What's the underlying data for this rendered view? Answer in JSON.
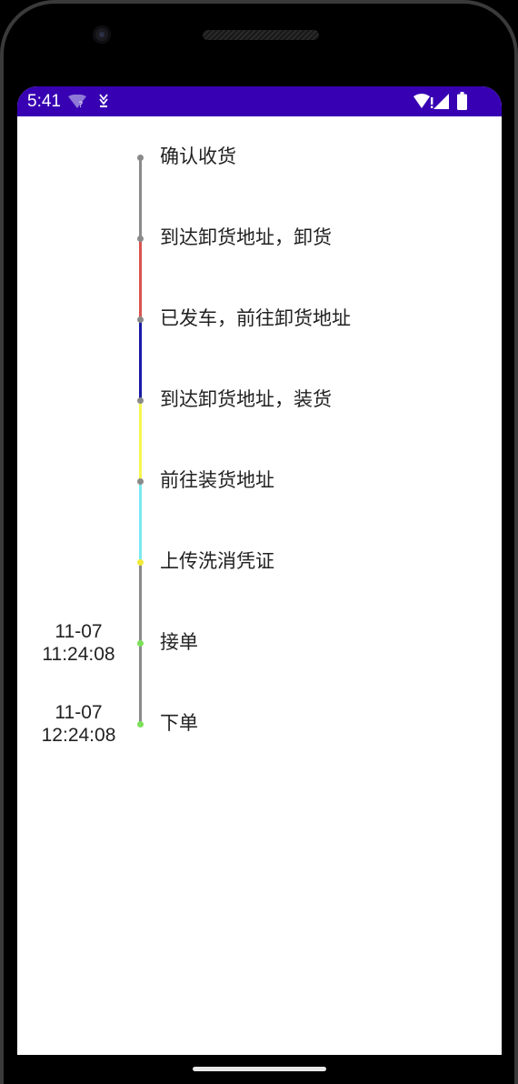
{
  "status_bar": {
    "time": "5:41",
    "wifi_badge": "?",
    "icons": [
      "wifi-question-icon",
      "download-icon",
      "wifi-alert-icon",
      "cell-signal-icon",
      "battery-icon"
    ],
    "color": "#3700b3"
  },
  "timeline": {
    "items": [
      {
        "label": "确认收货",
        "time_date": "",
        "time_clock": "",
        "dot_color": "#8a8a8a",
        "segment_color": "#8a8a8a"
      },
      {
        "label": "到达卸货地址，卸货",
        "time_date": "",
        "time_clock": "",
        "dot_color": "#8a8a8a",
        "segment_color": "#d9534f"
      },
      {
        "label": "已发车，前往卸货地址",
        "time_date": "",
        "time_clock": "",
        "dot_color": "#8a8a8a",
        "segment_color": "#1a1aa6"
      },
      {
        "label": "到达卸货地址，装货",
        "time_date": "",
        "time_clock": "",
        "dot_color": "#8a8a8a",
        "segment_color": "#f7f750"
      },
      {
        "label": "前往装货地址",
        "time_date": "",
        "time_clock": "",
        "dot_color": "#8a8a8a",
        "segment_color": "#7be8f0"
      },
      {
        "label": "上传洗消凭证",
        "time_date": "",
        "time_clock": "",
        "dot_color": "#f2ea3a",
        "segment_color": "#8a8a8a"
      },
      {
        "label": "接单",
        "time_date": "11-07",
        "time_clock": "11:24:08",
        "dot_color": "#7ce05a",
        "segment_color": "#8a8a8a"
      },
      {
        "label": "下单",
        "time_date": "11-07",
        "time_clock": "12:24:08",
        "dot_color": "#7ce05a",
        "segment_color": ""
      }
    ]
  }
}
